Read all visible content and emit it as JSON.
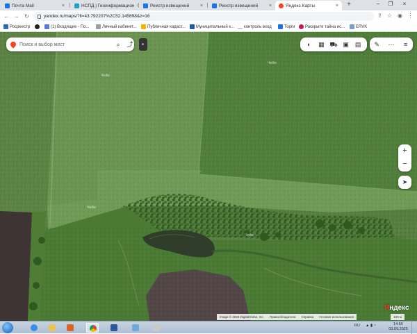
{
  "browser": {
    "tabs": [
      {
        "title": "Почта Mail",
        "color": "#1a73e8",
        "active": false
      },
      {
        "title": "НСПД | Геоинформацион",
        "color": "#22a0c8",
        "active": false
      },
      {
        "title": "Реестр извещений",
        "color": "#1a73e8",
        "active": false
      },
      {
        "title": "Реестр извещений",
        "color": "#1a73e8",
        "active": false
      },
      {
        "title": "Яндекс Карты",
        "color": "#fc3f1d",
        "active": true
      }
    ],
    "new_tab_icon": "+",
    "url": "yandex.ru/maps/?ll=43.792207%2C52.145898&z=16",
    "bookmarks": [
      {
        "label": "Росреестр",
        "color": "#2d6bb5"
      },
      {
        "label": "",
        "color": "#222222"
      },
      {
        "label": "(1) Входящие - По...",
        "color": "#5b7bd6"
      },
      {
        "label": "Личный кабинет...",
        "color": "#9aa0a6"
      },
      {
        "label": "Публичная кадаст...",
        "color": "#f4b400"
      },
      {
        "label": "Муниципальный к...",
        "color": "#1e5aa8"
      },
      {
        "label": "контроль вход",
        "color": "#9aa0a6"
      },
      {
        "label": "Торги",
        "color": "#1a73e8"
      },
      {
        "label": "Раскрыте тайна ис...",
        "color": "#c2185b"
      },
      {
        "label": "ERVK",
        "color": "#7aa0c8"
      }
    ]
  },
  "map": {
    "search_placeholder": "Поиск и выбор мест",
    "field_labels": [
      "Чейо",
      "Чейо",
      "Чейо",
      "Чейо"
    ],
    "zoom_in": "+",
    "zoom_out": "−",
    "logo_first": "Я",
    "logo_rest": "ндекс",
    "copyright": "Image © 2023 DigitalGlobe, Inc.",
    "links": [
      "Правообладатели",
      "Справка",
      "Условия использования"
    ],
    "scale": "100 м",
    "icons": [
      "search-icon",
      "route-icon",
      "layers-icon",
      "panorama-icon",
      "transport-icon",
      "bus-icon",
      "traffic-icon",
      "ruler-icon",
      "more-icon",
      "menu-icon",
      "locate-icon"
    ]
  },
  "taskbar": {
    "lang": "RU",
    "time": "14:56",
    "date": "03.09.2025"
  }
}
